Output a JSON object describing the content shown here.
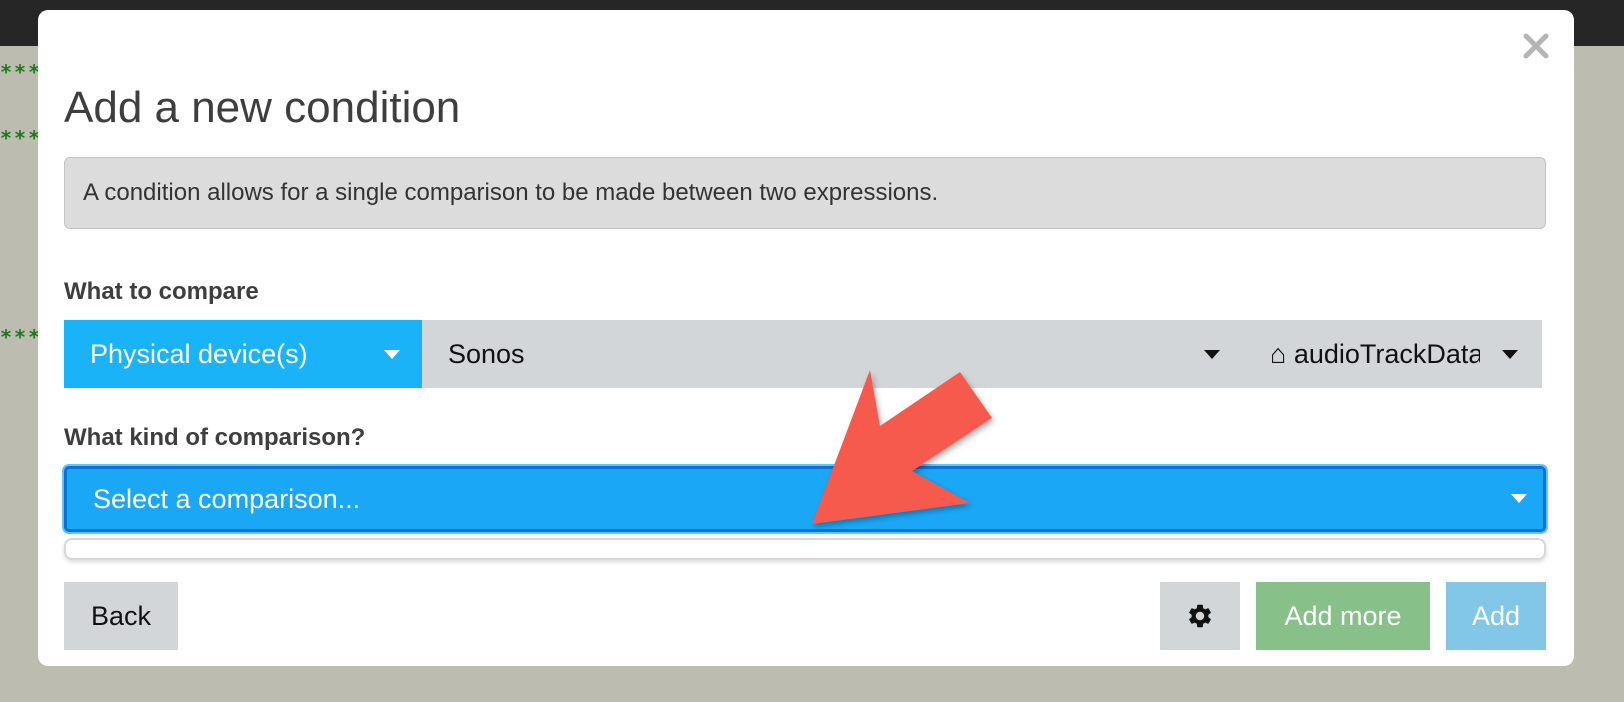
{
  "modal": {
    "title": "Add a new condition",
    "close_symbol": "×",
    "info_text": "A condition allows for a single comparison to be made between two expressions."
  },
  "compare": {
    "label": "What to compare",
    "type_select": "Physical device(s)",
    "device_select": "Sonos",
    "attribute_icon": "⌂",
    "attribute_select": "audioTrackData"
  },
  "comparison": {
    "label": "What kind of comparison?",
    "select": "Select a comparison..."
  },
  "buttons": {
    "back": "Back",
    "settings_icon": "gear-icon",
    "add_more": "Add more",
    "add": "Add"
  },
  "background": {
    "stars": "***"
  },
  "colors": {
    "primary": "#1bb3f7",
    "success": "#88c08a",
    "info": "#82c7e7",
    "annotation": "#f55a4e"
  }
}
